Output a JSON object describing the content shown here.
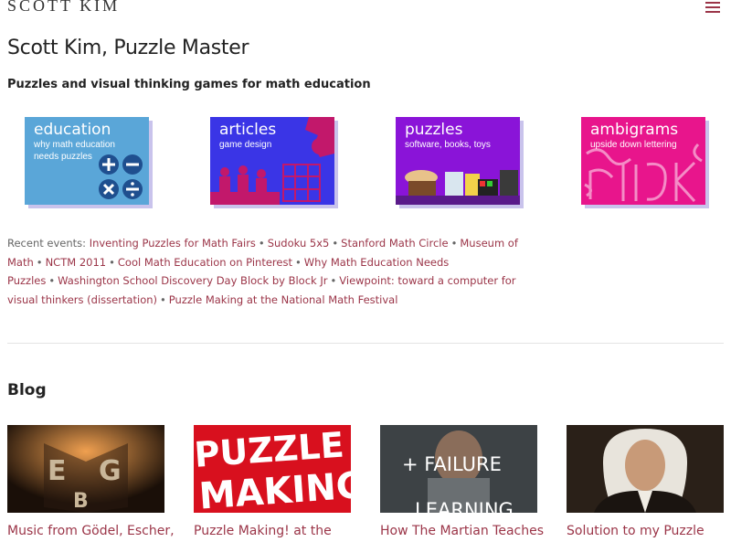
{
  "header": {
    "logo": "SCOTT KIM"
  },
  "page_title": "Scott Kim, Puzzle Master",
  "tagline": "Puzzles and visual thinking games for math education",
  "tiles": [
    {
      "title": "education",
      "subtitle_1": "why math education",
      "subtitle_2": "needs puzzles",
      "color": "#5aa6d8"
    },
    {
      "title": "articles",
      "subtitle_1": "game design",
      "subtitle_2": "",
      "color": "#3a35e6"
    },
    {
      "title": "puzzles",
      "subtitle_1": "software, books, toys",
      "subtitle_2": "",
      "color": "#8a14d8"
    },
    {
      "title": "ambigrams",
      "subtitle_1": "upside down lettering",
      "subtitle_2": "",
      "color": "#e8158c"
    }
  ],
  "events": {
    "label": "Recent events: ",
    "links": [
      "Inventing Puzzles for Math Fairs",
      "Sudoku 5x5",
      "Stanford Math Circle",
      "Museum of Math",
      "NCTM 2011",
      "Cool Math Education on Pinterest",
      "Why Math Education Needs Puzzles",
      "Washington School Discovery Day Block by Block Jr",
      "Viewpoint: toward a computer for visual thinkers (dissertation)",
      "Puzzle Making at the National Math Festival"
    ],
    "separator": "•"
  },
  "blog": {
    "heading": "Blog",
    "posts": [
      {
        "title": "Music from Gödel, Escher,",
        "thumb_letters": "E G B"
      },
      {
        "title": "Puzzle Making! at the",
        "thumb_text_1": "PUZZLE",
        "thumb_text_2": "MAKING"
      },
      {
        "title": "How The Martian Teaches",
        "thumb_text_1": "+ FAILURE",
        "thumb_text_2": "LEARNING"
      },
      {
        "title": "Solution to my Puzzle"
      }
    ]
  },
  "colors": {
    "accent": "#9b3548",
    "tile_shadow": "#c9c3ec"
  }
}
